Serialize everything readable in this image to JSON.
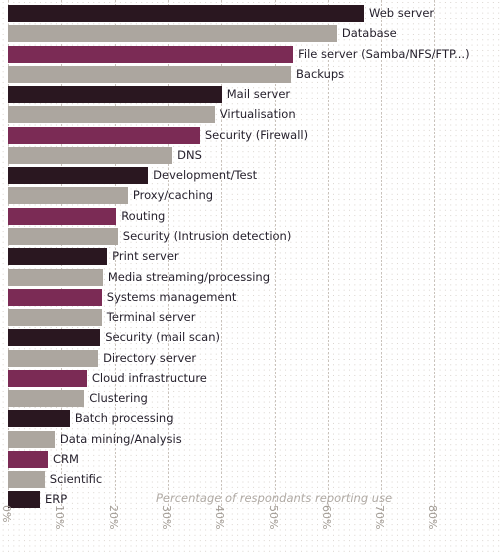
{
  "chart_data": {
    "type": "bar",
    "orientation": "horizontal",
    "title": "",
    "subtitle": "",
    "xlabel": "Percentage of respondants reporting use",
    "ylabel": "",
    "xlim": [
      0,
      82
    ],
    "xticks": [
      0,
      10,
      20,
      30,
      40,
      50,
      60,
      70,
      80
    ],
    "xtick_labels": [
      "0%",
      "10%",
      "20%",
      "30%",
      "40%",
      "50%",
      "60%",
      "70%",
      "80%"
    ],
    "grid": true,
    "legend": "none",
    "categories": [
      "Web server",
      "Database",
      "File server (Samba/NFS/FTP...)",
      "Backups",
      "Mail server",
      "Virtualisation",
      "Security (Firewall)",
      "DNS",
      "Development/Test",
      "Proxy/caching",
      "Routing",
      "Security (Intrusion detection)",
      "Print server",
      "Media streaming/processing",
      "Systems management",
      "Terminal server",
      "Security (mail scan)",
      "Directory server",
      "Cloud infrastructure",
      "Clustering",
      "Batch processing",
      "Data mining/Analysis",
      "CRM",
      "Scientific",
      "ERP"
    ],
    "values": [
      66.8,
      61.7,
      53.5,
      53.1,
      40.1,
      38.8,
      36.0,
      30.8,
      26.3,
      22.5,
      20.3,
      20.6,
      18.6,
      17.8,
      17.6,
      17.6,
      17.3,
      16.9,
      14.8,
      14.3,
      11.6,
      8.8,
      7.5,
      6.9,
      6.0
    ],
    "bar_colors": [
      "#2a1720",
      "#aca69f",
      "#7b2b55",
      "#aca69f",
      "#2a1720",
      "#aca69f",
      "#7b2b55",
      "#aca69f",
      "#2a1720",
      "#aca69f",
      "#7b2b55",
      "#aca69f",
      "#2a1720",
      "#aca69f",
      "#7b2b55",
      "#aca69f",
      "#2a1720",
      "#aca69f",
      "#7b2b55",
      "#aca69f",
      "#2a1720",
      "#aca69f",
      "#7b2b55",
      "#aca69f",
      "#2a1720"
    ]
  },
  "colors": {
    "dark": "#2a1720",
    "maroon": "#7b2b55",
    "grey": "#aca69f",
    "label_text": "#241f2b",
    "tick_text": "#a39d96",
    "note_text": "#b0aaa4",
    "grid_dot": "#d8d2cc",
    "background": "#ffffff"
  }
}
